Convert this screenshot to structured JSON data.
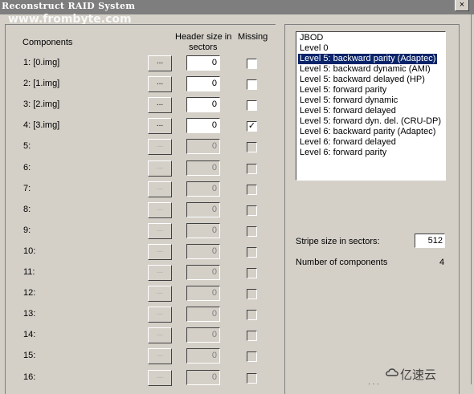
{
  "window": {
    "title": "Reconstruct RAID System",
    "close_label": "×",
    "watermark": "www.frombyte.com"
  },
  "headers": {
    "components": "Components",
    "header_size_line1": "Header size in",
    "header_size_line2": "sectors",
    "missing": "Missing"
  },
  "browse_label": "...",
  "components": [
    {
      "label": "1:   [0.img]",
      "sectors": "0",
      "missing": "",
      "enabled": true
    },
    {
      "label": "2:   [1.img]",
      "sectors": "0",
      "missing": "",
      "enabled": true
    },
    {
      "label": "3:   [2.img]",
      "sectors": "0",
      "missing": "",
      "enabled": true
    },
    {
      "label": "4:   [3.img]",
      "sectors": "0",
      "missing": "✓",
      "enabled": true
    },
    {
      "label": "5:",
      "sectors": "0",
      "missing": "",
      "enabled": false
    },
    {
      "label": "6:",
      "sectors": "0",
      "missing": "",
      "enabled": false
    },
    {
      "label": "7:",
      "sectors": "0",
      "missing": "",
      "enabled": false
    },
    {
      "label": "8:",
      "sectors": "0",
      "missing": "",
      "enabled": false
    },
    {
      "label": "9:",
      "sectors": "0",
      "missing": "",
      "enabled": false
    },
    {
      "label": "10:",
      "sectors": "0",
      "missing": "",
      "enabled": false
    },
    {
      "label": "11:",
      "sectors": "0",
      "missing": "",
      "enabled": false
    },
    {
      "label": "12:",
      "sectors": "0",
      "missing": "",
      "enabled": false
    },
    {
      "label": "13:",
      "sectors": "0",
      "missing": "",
      "enabled": false
    },
    {
      "label": "14:",
      "sectors": "0",
      "missing": "",
      "enabled": false
    },
    {
      "label": "15:",
      "sectors": "0",
      "missing": "",
      "enabled": false
    },
    {
      "label": "16:",
      "sectors": "0",
      "missing": "",
      "enabled": false
    }
  ],
  "raid_types": [
    "JBOD",
    "Level 0",
    "Level 5: backward parity (Adaptec)",
    "Level 5: backward dynamic (AMI)",
    "Level 5: backward delayed (HP)",
    "Level 5: forward parity",
    "Level 5: forward dynamic",
    "Level 5: forward delayed",
    "Level 5: forward dyn. del. (CRU-DP)",
    "Level 6: backward parity (Adaptec)",
    "Level 6: forward delayed",
    "Level 6: forward parity"
  ],
  "selected_raid_type": "Level 5: backward parity (Adaptec)",
  "stripe": {
    "label": "Stripe size in sectors:",
    "value": "512"
  },
  "num_components": {
    "label": "Number of components",
    "value": "4"
  },
  "footer_logo": "亿速云",
  "colors": {
    "selection": "#0a246a",
    "dialog": "#d4d0c8"
  }
}
